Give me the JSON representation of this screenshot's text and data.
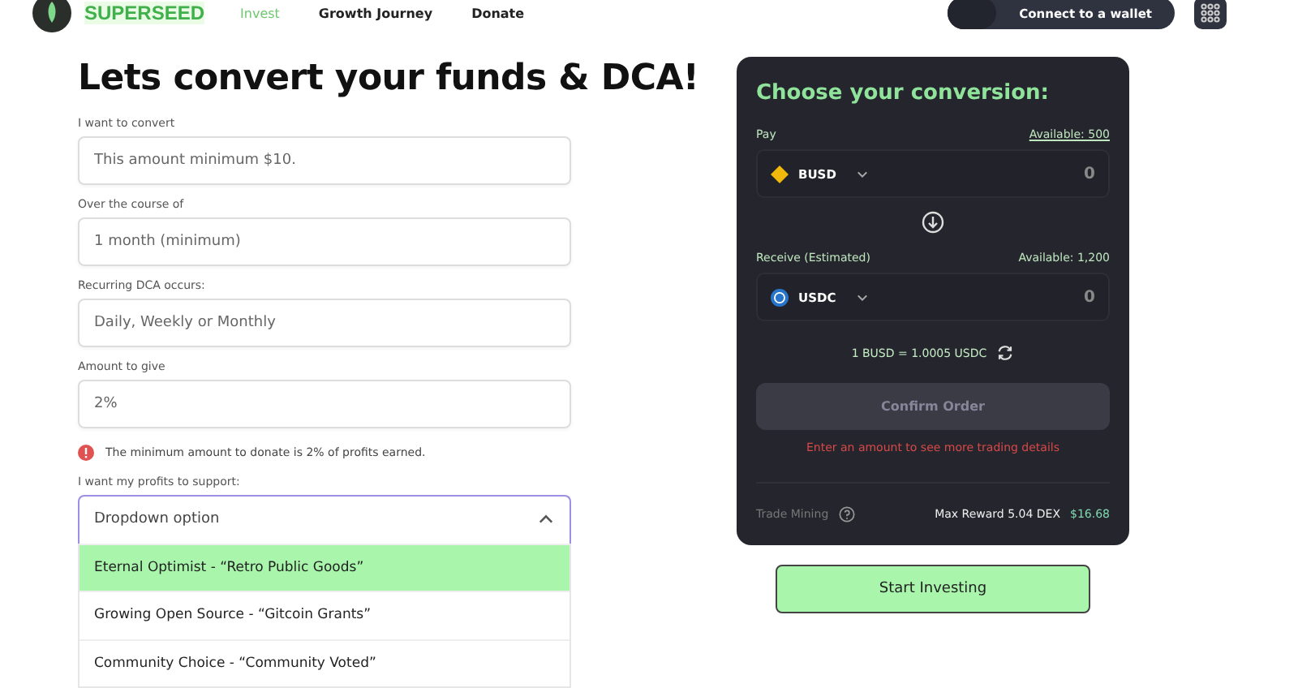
{
  "header": {
    "brand": "SUPERSEED",
    "nav": [
      {
        "label": "Invest",
        "selected": true
      },
      {
        "label": "Growth Journey",
        "selected": false
      },
      {
        "label": "Donate",
        "selected": false
      }
    ],
    "wallet_button": "Connect to a wallet"
  },
  "form": {
    "title": "Lets convert your funds & DCA!",
    "fields": [
      {
        "label": "I want to convert",
        "placeholder": "This amount minimum $10."
      },
      {
        "label": "Over the course of",
        "placeholder": "1 month (minimum)"
      },
      {
        "label": "Recurring DCA occurs:",
        "placeholder": "Daily, Weekly or Monthly"
      },
      {
        "label": "Amount to give",
        "placeholder": "2%"
      }
    ],
    "error": "The minimum amount to donate is 2% of profits earned.",
    "support": {
      "label": "I want my profits to support:",
      "placeholder": "Dropdown option",
      "expanded": true,
      "options": [
        {
          "label": "Eternal Optimist - “Retro Public Goods”",
          "selected": true
        },
        {
          "label": "Growing Open Source - “Gitcoin Grants”",
          "selected": false
        },
        {
          "label": "Community Choice - “Community Voted”",
          "selected": false
        }
      ]
    }
  },
  "conversion": {
    "title": "Choose your conversion:",
    "sides": [
      {
        "label": "Pay",
        "available": "Available: 500",
        "token": "BUSD",
        "kind": "busd",
        "amount": "0"
      },
      {
        "label": "Receive (Estimated)",
        "available": "Available: 1,200",
        "token": "USDC",
        "kind": "usdc",
        "amount": "0"
      }
    ],
    "rate": "1 BUSD = 1.0005 USDC",
    "confirm": {
      "label": "Confirm Order",
      "disabled": true
    },
    "hint": "Enter an amount to see more trading details",
    "trade_mining": "Trade Mining",
    "reward": "Max Reward 5.04 DEX",
    "reward_value": "$16.68"
  },
  "start_button": "Start Investing"
}
